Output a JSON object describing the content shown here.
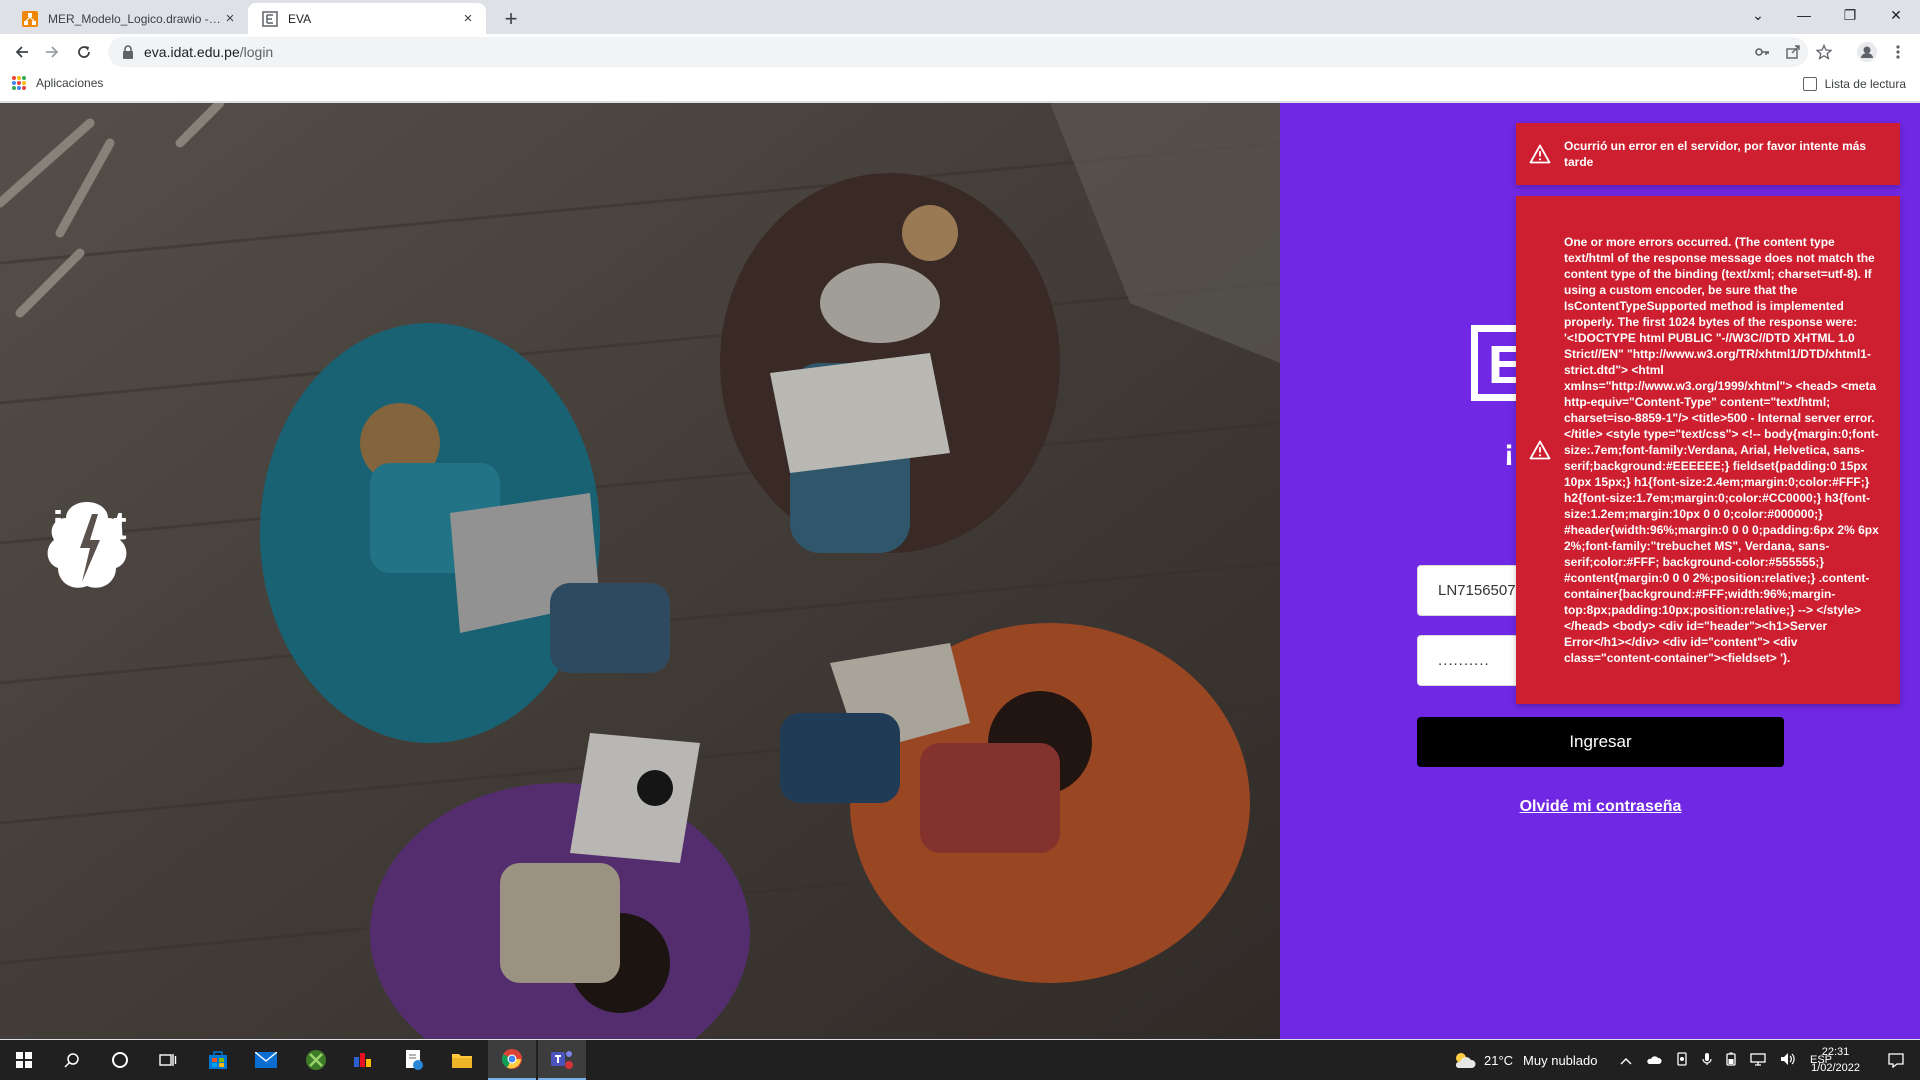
{
  "browser": {
    "tabs": [
      {
        "title": "MER_Modelo_Logico.drawio - dia",
        "close": "×"
      },
      {
        "title": "EVA",
        "close": "×"
      }
    ],
    "new_tab": "+",
    "window_controls": {
      "dropdown": "⌄",
      "minimize": "—",
      "restore": "❐",
      "close": "✕"
    },
    "url_host": "eva.idat.edu.pe",
    "url_path": "/login",
    "bookmarks": {
      "apps": "Aplicaciones",
      "reading_list": "Lista de lectura"
    }
  },
  "hero": {
    "brand_word": "idat"
  },
  "login": {
    "greeting": "¡",
    "user_value": "LN7156507",
    "password_mask": "..........",
    "submit_label": "Ingresar",
    "forgot_label": "Olvidé mi contraseña"
  },
  "errors": [
    {
      "text": "Ocurrió un error en el servidor, por favor intente más tarde"
    },
    {
      "text": "One or more errors occurred. (The content type text/html of the response message does not match the content type of the binding (text/xml; charset=utf-8). If using a custom encoder, be sure that the IsContentTypeSupported method is implemented properly. The first 1024 bytes of the response were: '<!DOCTYPE html PUBLIC \"-//W3C//DTD XHTML 1.0 Strict//EN\" \"http://www.w3.org/TR/xhtml1/DTD/xhtml1-strict.dtd\"> <html xmlns=\"http://www.w3.org/1999/xhtml\"> <head> <meta http-equiv=\"Content-Type\" content=\"text/html; charset=iso-8859-1\"/> <title>500 - Internal server error.</title> <style type=\"text/css\"> <!-- body{margin:0;font-size:.7em;font-family:Verdana, Arial, Helvetica, sans-serif;background:#EEEEEE;} fieldset{padding:0 15px 10px 15px;} h1{font-size:2.4em;margin:0;color:#FFF;} h2{font-size:1.7em;margin:0;color:#CC0000;} h3{font-size:1.2em;margin:10px 0 0 0;color:#000000;} #header{width:96%;margin:0 0 0 0;padding:6px 2% 6px 2%;font-family:\"trebuchet MS\", Verdana, sans-serif;color:#FFF; background-color:#555555;} #content{margin:0 0 0 2%;position:relative;} .content-container{background:#FFF;width:96%;margin-top:8px;padding:10px;position:relative;} --> </style> </head> <body> <div id=\"header\"><h1>Server Error</h1></div> <div id=\"content\"> <div class=\"content-container\"><fieldset> ')."
    }
  ],
  "taskbar": {
    "weather_temp": "21°C",
    "weather_text": "Muy nublado",
    "language": "ESP",
    "time": "22:31",
    "date": "1/02/2022"
  },
  "colors": {
    "login_panel": "#7028e4",
    "error_toast": "#cd1f2f",
    "login_button": "#000000"
  }
}
